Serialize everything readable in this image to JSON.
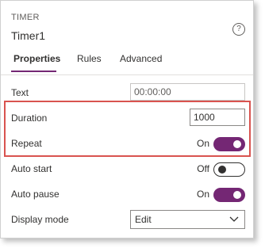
{
  "header": {
    "control_type": "TIMER",
    "control_name": "Timer1",
    "help_glyph": "?"
  },
  "tabs": [
    {
      "label": "Properties",
      "active": true
    },
    {
      "label": "Rules",
      "active": false
    },
    {
      "label": "Advanced",
      "active": false
    }
  ],
  "properties": {
    "text": {
      "label": "Text",
      "value": "00:00:00"
    },
    "duration": {
      "label": "Duration",
      "value": "1000"
    },
    "repeat": {
      "label": "Repeat",
      "state": "On"
    },
    "auto_start": {
      "label": "Auto start",
      "state": "Off"
    },
    "auto_pause": {
      "label": "Auto pause",
      "state": "On"
    },
    "display_mode": {
      "label": "Display mode",
      "value": "Edit"
    }
  },
  "colors": {
    "accent": "#742774",
    "highlight": "#d9534f"
  }
}
